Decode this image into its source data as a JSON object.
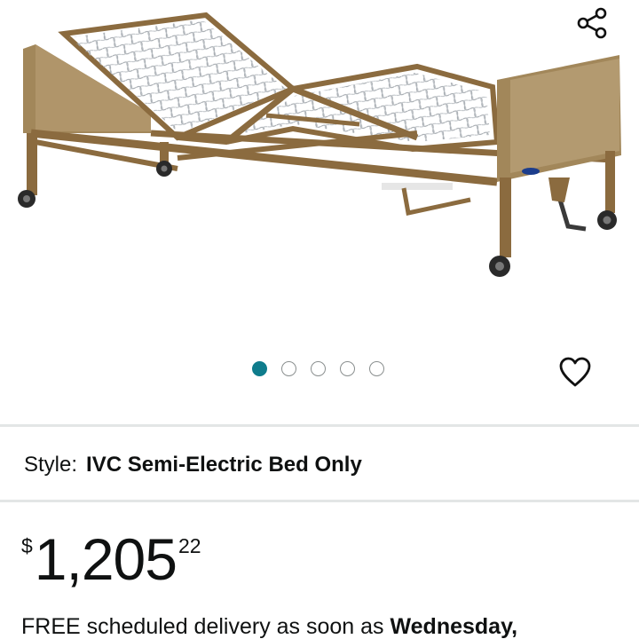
{
  "gallery": {
    "image_alt": "Invacare semi-electric hospital bed frame",
    "share_icon": "share-icon",
    "favorite_icon": "heart-outline-icon",
    "dots": [
      {
        "active": true
      },
      {
        "active": false
      },
      {
        "active": false
      },
      {
        "active": false
      },
      {
        "active": false
      }
    ],
    "active_dot_color": "#0f7c8c"
  },
  "style": {
    "label": "Style:",
    "value": "IVC Semi-Electric Bed Only"
  },
  "price": {
    "symbol": "$",
    "whole": "1,205",
    "fraction": "22"
  },
  "delivery": {
    "text": "FREE scheduled delivery as soon as",
    "date": "Wednesday,"
  }
}
